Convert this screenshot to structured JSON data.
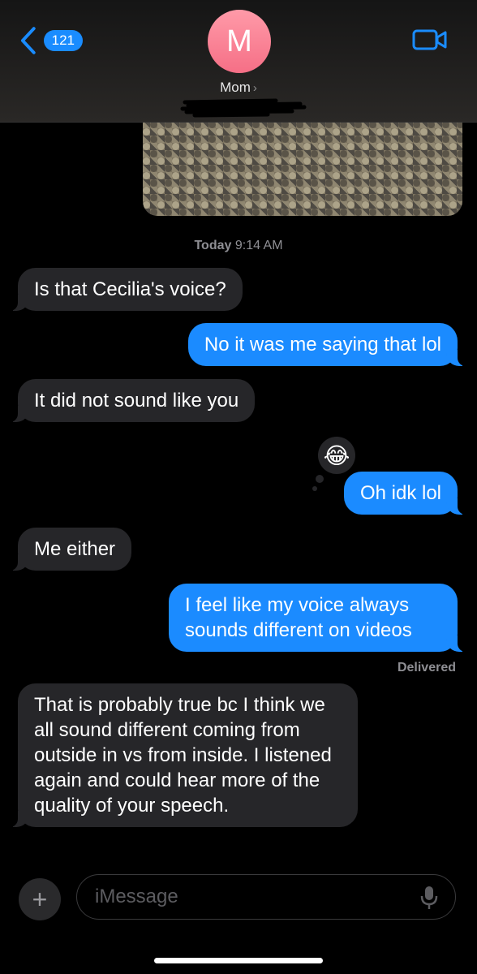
{
  "header": {
    "back_count": "121",
    "avatar_initial": "M",
    "contact_name": "Mom",
    "contact_chevron": "›",
    "icons": [
      "chevron-left-icon",
      "video-camera-icon"
    ]
  },
  "conversation": {
    "timestamp_day": "Today",
    "timestamp_time": "9:14 AM",
    "messages": [
      {
        "from": "them",
        "text": "Is that Cecilia's voice?"
      },
      {
        "from": "me",
        "text": "No it was me saying that lol"
      },
      {
        "from": "them",
        "text": "It did not sound like you"
      },
      {
        "from": "me",
        "text": "Oh idk lol",
        "tapback": "😂"
      },
      {
        "from": "them",
        "text": "Me either"
      },
      {
        "from": "me",
        "text": "I feel like my voice always sounds different on videos"
      },
      {
        "from": "them",
        "text": "That is probably true bc I think we all sound different coming from outside in vs from inside. I listened again and could hear more of the quality of your speech."
      }
    ],
    "delivered_label": "Delivered"
  },
  "composer": {
    "plus_label": "+",
    "placeholder": "iMessage",
    "icons": [
      "plus-icon",
      "microphone-icon"
    ]
  },
  "colors": {
    "accent_blue": "#1b8bff",
    "incoming_bubble": "#262629",
    "avatar_pink": "#f56f86"
  }
}
